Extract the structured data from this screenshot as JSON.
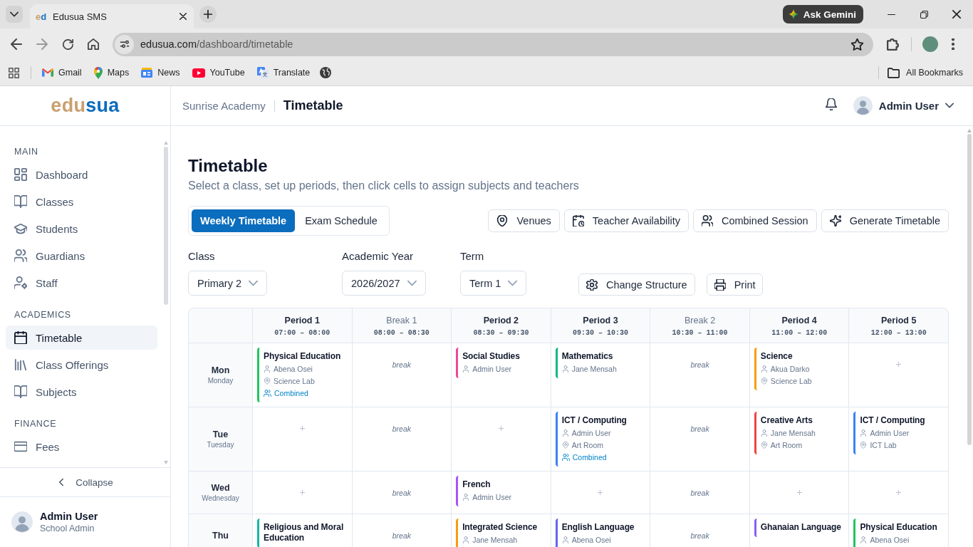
{
  "browser": {
    "tab": {
      "favicon": "ed",
      "title": "Edusua SMS"
    },
    "assistant": "Ask Gemini",
    "url": {
      "host": "edusua.com",
      "path": "/dashboard/timetable"
    },
    "bookmarks": [
      {
        "label": "Gmail"
      },
      {
        "label": "Maps"
      },
      {
        "label": "News"
      },
      {
        "label": "YouTube"
      },
      {
        "label": "Translate"
      }
    ],
    "all_bookmarks": "All Bookmarks"
  },
  "sidebar": {
    "logo": {
      "primary": "edu",
      "accent": "sua"
    },
    "sections": [
      {
        "heading": "MAIN",
        "items": [
          {
            "label": "Dashboard",
            "selected": false
          },
          {
            "label": "Classes",
            "selected": false
          },
          {
            "label": "Students",
            "selected": false
          },
          {
            "label": "Guardians",
            "selected": false
          },
          {
            "label": "Staff",
            "selected": false
          }
        ]
      },
      {
        "heading": "ACADEMICS",
        "items": [
          {
            "label": "Timetable",
            "selected": true
          },
          {
            "label": "Class Offerings",
            "selected": false
          },
          {
            "label": "Subjects",
            "selected": false
          }
        ]
      },
      {
        "heading": "FINANCE",
        "items": [
          {
            "label": "Fees",
            "selected": false
          }
        ]
      }
    ],
    "collapse": "Collapse",
    "user": {
      "name": "Admin User",
      "role": "School Admin"
    }
  },
  "header": {
    "school": "Sunrise Academy",
    "page": "Timetable",
    "user": "Admin User"
  },
  "page": {
    "title": "Timetable",
    "subtitle": "Select a class, set up periods, then click cells to assign subjects and teachers",
    "tabs": [
      {
        "label": "Weekly Timetable",
        "selected": true
      },
      {
        "label": "Exam Schedule",
        "selected": false
      }
    ],
    "actions": [
      "Venues",
      "Teacher Availability",
      "Combined Session",
      "Generate Timetable"
    ],
    "filters": [
      {
        "label": "Class",
        "value": "Primary 2"
      },
      {
        "label": "Academic Year",
        "value": "2026/2027"
      },
      {
        "label": "Term",
        "value": "Term 1"
      }
    ],
    "tools": [
      "Change Structure",
      "Print"
    ]
  },
  "timetable": {
    "columns": [
      {
        "kind": "period",
        "label": "Period 1",
        "time": "07:00 – 08:00"
      },
      {
        "kind": "break",
        "label": "Break 1",
        "time": "08:00 – 08:30"
      },
      {
        "kind": "period",
        "label": "Period 2",
        "time": "08:30 – 09:30"
      },
      {
        "kind": "period",
        "label": "Period 3",
        "time": "09:30 – 10:30"
      },
      {
        "kind": "break",
        "label": "Break 2",
        "time": "10:30 – 11:00"
      },
      {
        "kind": "period",
        "label": "Period 4",
        "time": "11:00 – 12:00"
      },
      {
        "kind": "period",
        "label": "Period 5",
        "time": "12:00 – 13:00"
      }
    ],
    "rows": [
      {
        "day": "Mon",
        "full": "Monday",
        "cells": [
          {
            "kind": "lesson",
            "subject": "Physical Education",
            "color": "#22c55e",
            "teacher": "Abena Osei",
            "venue": "Science Lab",
            "combined": "Combined"
          },
          {
            "kind": "break",
            "label": "break"
          },
          {
            "kind": "lesson",
            "subject": "Social Studies",
            "color": "#ec4899",
            "teacher": "Admin User"
          },
          {
            "kind": "lesson",
            "subject": "Mathematics",
            "color": "#10b981",
            "teacher": "Jane Mensah"
          },
          {
            "kind": "break",
            "label": "break"
          },
          {
            "kind": "lesson",
            "subject": "Science",
            "color": "#f59e0b",
            "teacher": "Akua Darko",
            "venue": "Science Lab"
          },
          {
            "kind": "empty"
          }
        ]
      },
      {
        "day": "Tue",
        "full": "Tuesday",
        "cells": [
          {
            "kind": "empty"
          },
          {
            "kind": "break",
            "label": "break"
          },
          {
            "kind": "empty"
          },
          {
            "kind": "lesson",
            "subject": "ICT / Computing",
            "color": "#3b82f6",
            "teacher": "Admin User",
            "venue": "Art Room",
            "combined": "Combined"
          },
          {
            "kind": "break",
            "label": "break"
          },
          {
            "kind": "lesson",
            "subject": "Creative Arts",
            "color": "#ef4444",
            "teacher": "Jane Mensah",
            "venue": "Art Room"
          },
          {
            "kind": "lesson",
            "subject": "ICT / Computing",
            "color": "#3b82f6",
            "teacher": "Admin User",
            "venue": "ICT Lab"
          }
        ]
      },
      {
        "day": "Wed",
        "full": "Wednesday",
        "cells": [
          {
            "kind": "empty"
          },
          {
            "kind": "break",
            "label": "break"
          },
          {
            "kind": "lesson",
            "subject": "French",
            "color": "#a855f7",
            "teacher": "Admin User"
          },
          {
            "kind": "empty"
          },
          {
            "kind": "break",
            "label": "break"
          },
          {
            "kind": "empty"
          },
          {
            "kind": "empty"
          }
        ]
      },
      {
        "day": "Thu",
        "cells": [
          {
            "kind": "lesson",
            "subject": "Religious and Moral Education",
            "color": "#14b8a6"
          },
          {
            "kind": "break",
            "label": "break"
          },
          {
            "kind": "lesson",
            "subject": "Integrated Science",
            "color": "#f59e0b",
            "teacher": "Jane Mensah"
          },
          {
            "kind": "lesson",
            "subject": "English Language",
            "color": "#6366f1",
            "teacher": "Abena Osei"
          },
          {
            "kind": "break",
            "label": "break"
          },
          {
            "kind": "lesson",
            "subject": "Ghanaian Language",
            "color": "#8b5cf6"
          },
          {
            "kind": "lesson",
            "subject": "Physical Education",
            "color": "#22c55e",
            "teacher": "Abena Osei"
          }
        ]
      }
    ]
  }
}
